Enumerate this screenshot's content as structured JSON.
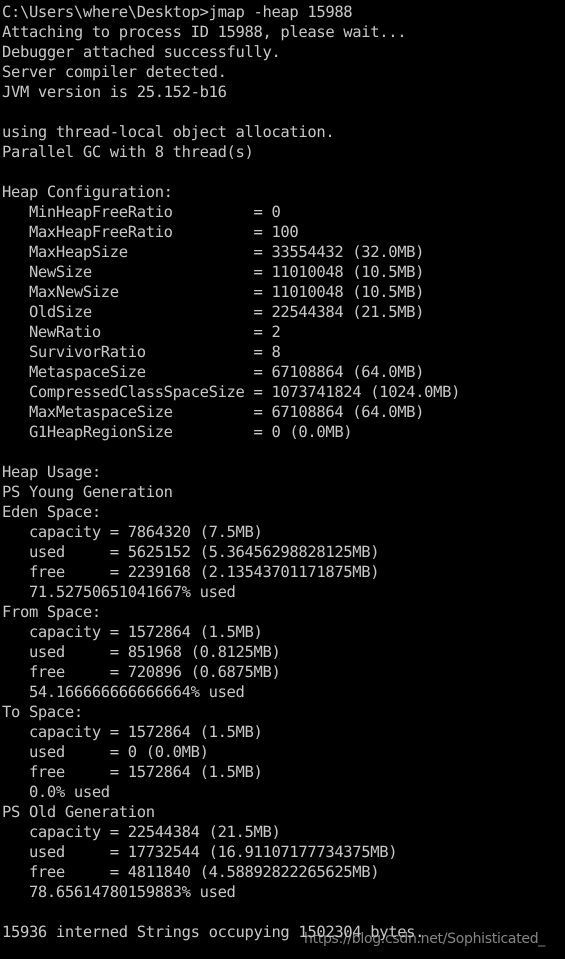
{
  "terminal": {
    "window_kind": "windows-command-prompt",
    "background_color": "#000000",
    "text_color": "#c8c8c8",
    "prompt_path": "C:\\Users\\where\\Desktop>",
    "command": "jmap -heap 15988",
    "lines": [
      "C:\\Users\\where\\Desktop>jmap -heap 15988",
      "Attaching to process ID 15988, please wait...",
      "Debugger attached successfully.",
      "Server compiler detected.",
      "JVM version is 25.152-b16",
      "",
      "using thread-local object allocation.",
      "Parallel GC with 8 thread(s)",
      "",
      "Heap Configuration:",
      "   MinHeapFreeRatio         = 0",
      "   MaxHeapFreeRatio         = 100",
      "   MaxHeapSize              = 33554432 (32.0MB)",
      "   NewSize                  = 11010048 (10.5MB)",
      "   MaxNewSize               = 11010048 (10.5MB)",
      "   OldSize                  = 22544384 (21.5MB)",
      "   NewRatio                 = 2",
      "   SurvivorRatio            = 8",
      "   MetaspaceSize            = 67108864 (64.0MB)",
      "   CompressedClassSpaceSize = 1073741824 (1024.0MB)",
      "   MaxMetaspaceSize         = 67108864 (64.0MB)",
      "   G1HeapRegionSize         = 0 (0.0MB)",
      "",
      "Heap Usage:",
      "PS Young Generation",
      "Eden Space:",
      "   capacity = 7864320 (7.5MB)",
      "   used     = 5625152 (5.36456298828125MB)",
      "   free     = 2239168 (2.13543701171875MB)",
      "   71.52750651041667% used",
      "From Space:",
      "   capacity = 1572864 (1.5MB)",
      "   used     = 851968 (0.8125MB)",
      "   free     = 720896 (0.6875MB)",
      "   54.166666666666664% used",
      "To Space:",
      "   capacity = 1572864 (1.5MB)",
      "   used     = 0 (0.0MB)",
      "   free     = 1572864 (1.5MB)",
      "   0.0% used",
      "PS Old Generation",
      "   capacity = 22544384 (21.5MB)",
      "   used     = 17732544 (16.91107177734375MB)",
      "   free     = 4811840 (4.58892822265625MB)",
      "   78.65614780159883% used",
      "",
      "15936 interned Strings occupying 1502304 bytes."
    ],
    "heap_configuration": {
      "MinHeapFreeRatio": "0",
      "MaxHeapFreeRatio": "100",
      "MaxHeapSize": "33554432 (32.0MB)",
      "NewSize": "11010048 (10.5MB)",
      "MaxNewSize": "11010048 (10.5MB)",
      "OldSize": "22544384 (21.5MB)",
      "NewRatio": "2",
      "SurvivorRatio": "8",
      "MetaspaceSize": "67108864 (64.0MB)",
      "CompressedClassSpaceSize": "1073741824 (1024.0MB)",
      "MaxMetaspaceSize": "67108864 (64.0MB)",
      "G1HeapRegionSize": "0 (0.0MB)"
    },
    "heap_usage": {
      "generation_young": "PS Young Generation",
      "eden_space": {
        "capacity": "7864320 (7.5MB)",
        "used": "5625152 (5.36456298828125MB)",
        "free": "2239168 (2.13543701171875MB)",
        "percent_used": "71.52750651041667% used"
      },
      "from_space": {
        "capacity": "1572864 (1.5MB)",
        "used": "851968 (0.8125MB)",
        "free": "720896 (0.6875MB)",
        "percent_used": "54.166666666666664% used"
      },
      "to_space": {
        "capacity": "1572864 (1.5MB)",
        "used": "0 (0.0MB)",
        "free": "1572864 (1.5MB)",
        "percent_used": "0.0% used"
      },
      "generation_old": "PS Old Generation",
      "old_generation": {
        "capacity": "22544384 (21.5MB)",
        "used": "17732544 (16.91107177734375MB)",
        "free": "4811840 (4.58892822265625MB)",
        "percent_used": "78.65614780159883% used"
      }
    },
    "footer": "15936 interned Strings occupying 1502304 bytes."
  },
  "watermark": {
    "text": "https://blog.csdn.net/Sophisticated_"
  }
}
